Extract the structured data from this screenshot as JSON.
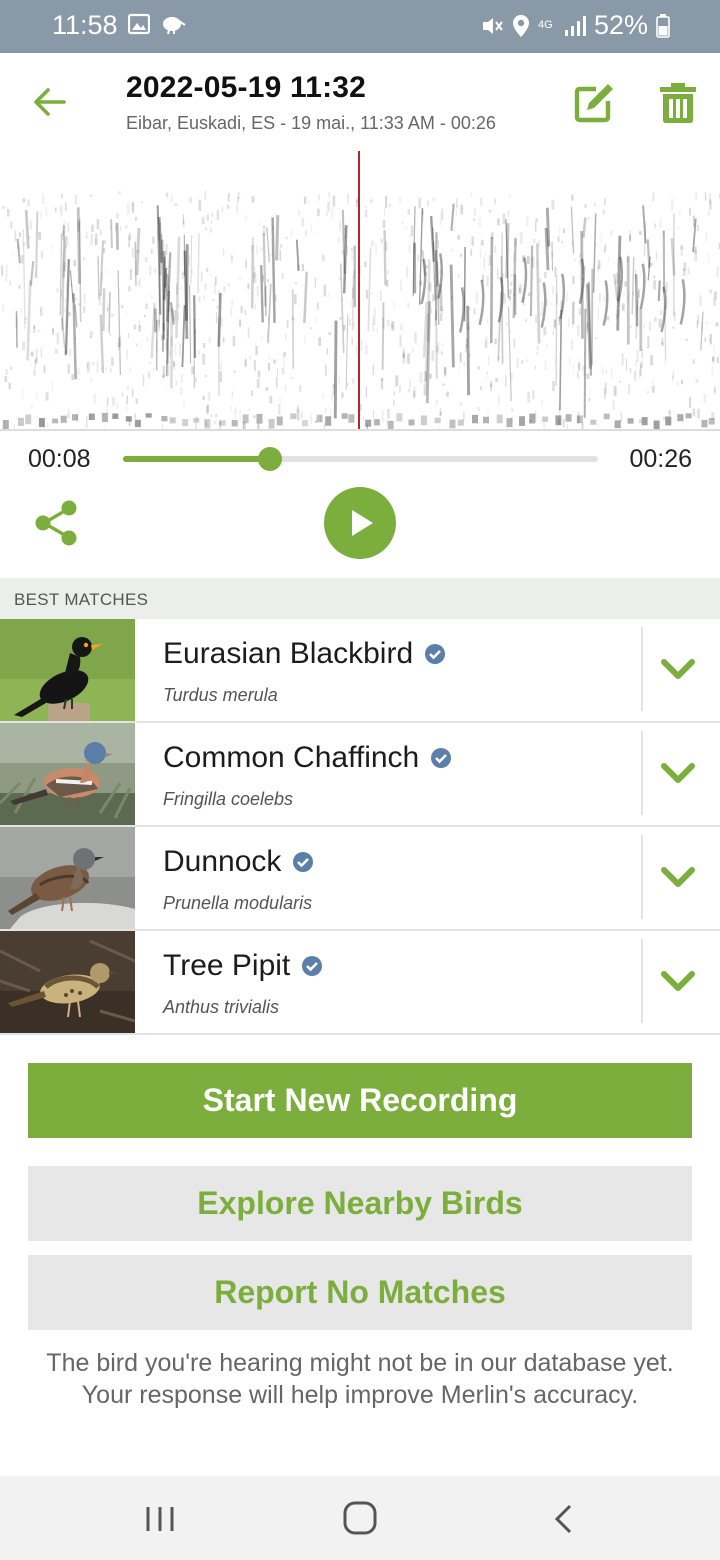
{
  "status_bar": {
    "time": "11:58",
    "battery": "52%",
    "network": "4G",
    "icons": [
      "gallery-icon",
      "kiwi-icon",
      "mute-icon",
      "location-icon",
      "signal-icon",
      "battery-icon"
    ]
  },
  "header": {
    "title": "2022-05-19 11:32",
    "subtitle": "Eibar, Euskadi, ES - 19 mai., 11:33 AM - 00:26",
    "icons": [
      "back-arrow-icon",
      "edit-icon",
      "trash-icon"
    ]
  },
  "player": {
    "current_time": "00:08",
    "total_time": "00:26",
    "progress": 0.31
  },
  "matches": {
    "section_label": "BEST MATCHES",
    "items": [
      {
        "common": "Eurasian Blackbird",
        "scientific": "Turdus merula"
      },
      {
        "common": "Common Chaffinch",
        "scientific": "Fringilla coelebs"
      },
      {
        "common": "Dunnock",
        "scientific": "Prunella modularis"
      },
      {
        "common": "Tree Pipit",
        "scientific": "Anthus trivialis"
      }
    ]
  },
  "actions": {
    "start_recording": "Start New Recording",
    "explore_nearby": "Explore Nearby Birds",
    "report_no_matches": "Report No Matches",
    "note": "The bird you're hearing might not be in our database yet. Your response will help improve Merlin's accuracy."
  },
  "colors": {
    "accent": "#7cae3e",
    "status_bar": "#8a99a8",
    "playhead": "#b3262d",
    "verified": "#5a7fa8"
  }
}
